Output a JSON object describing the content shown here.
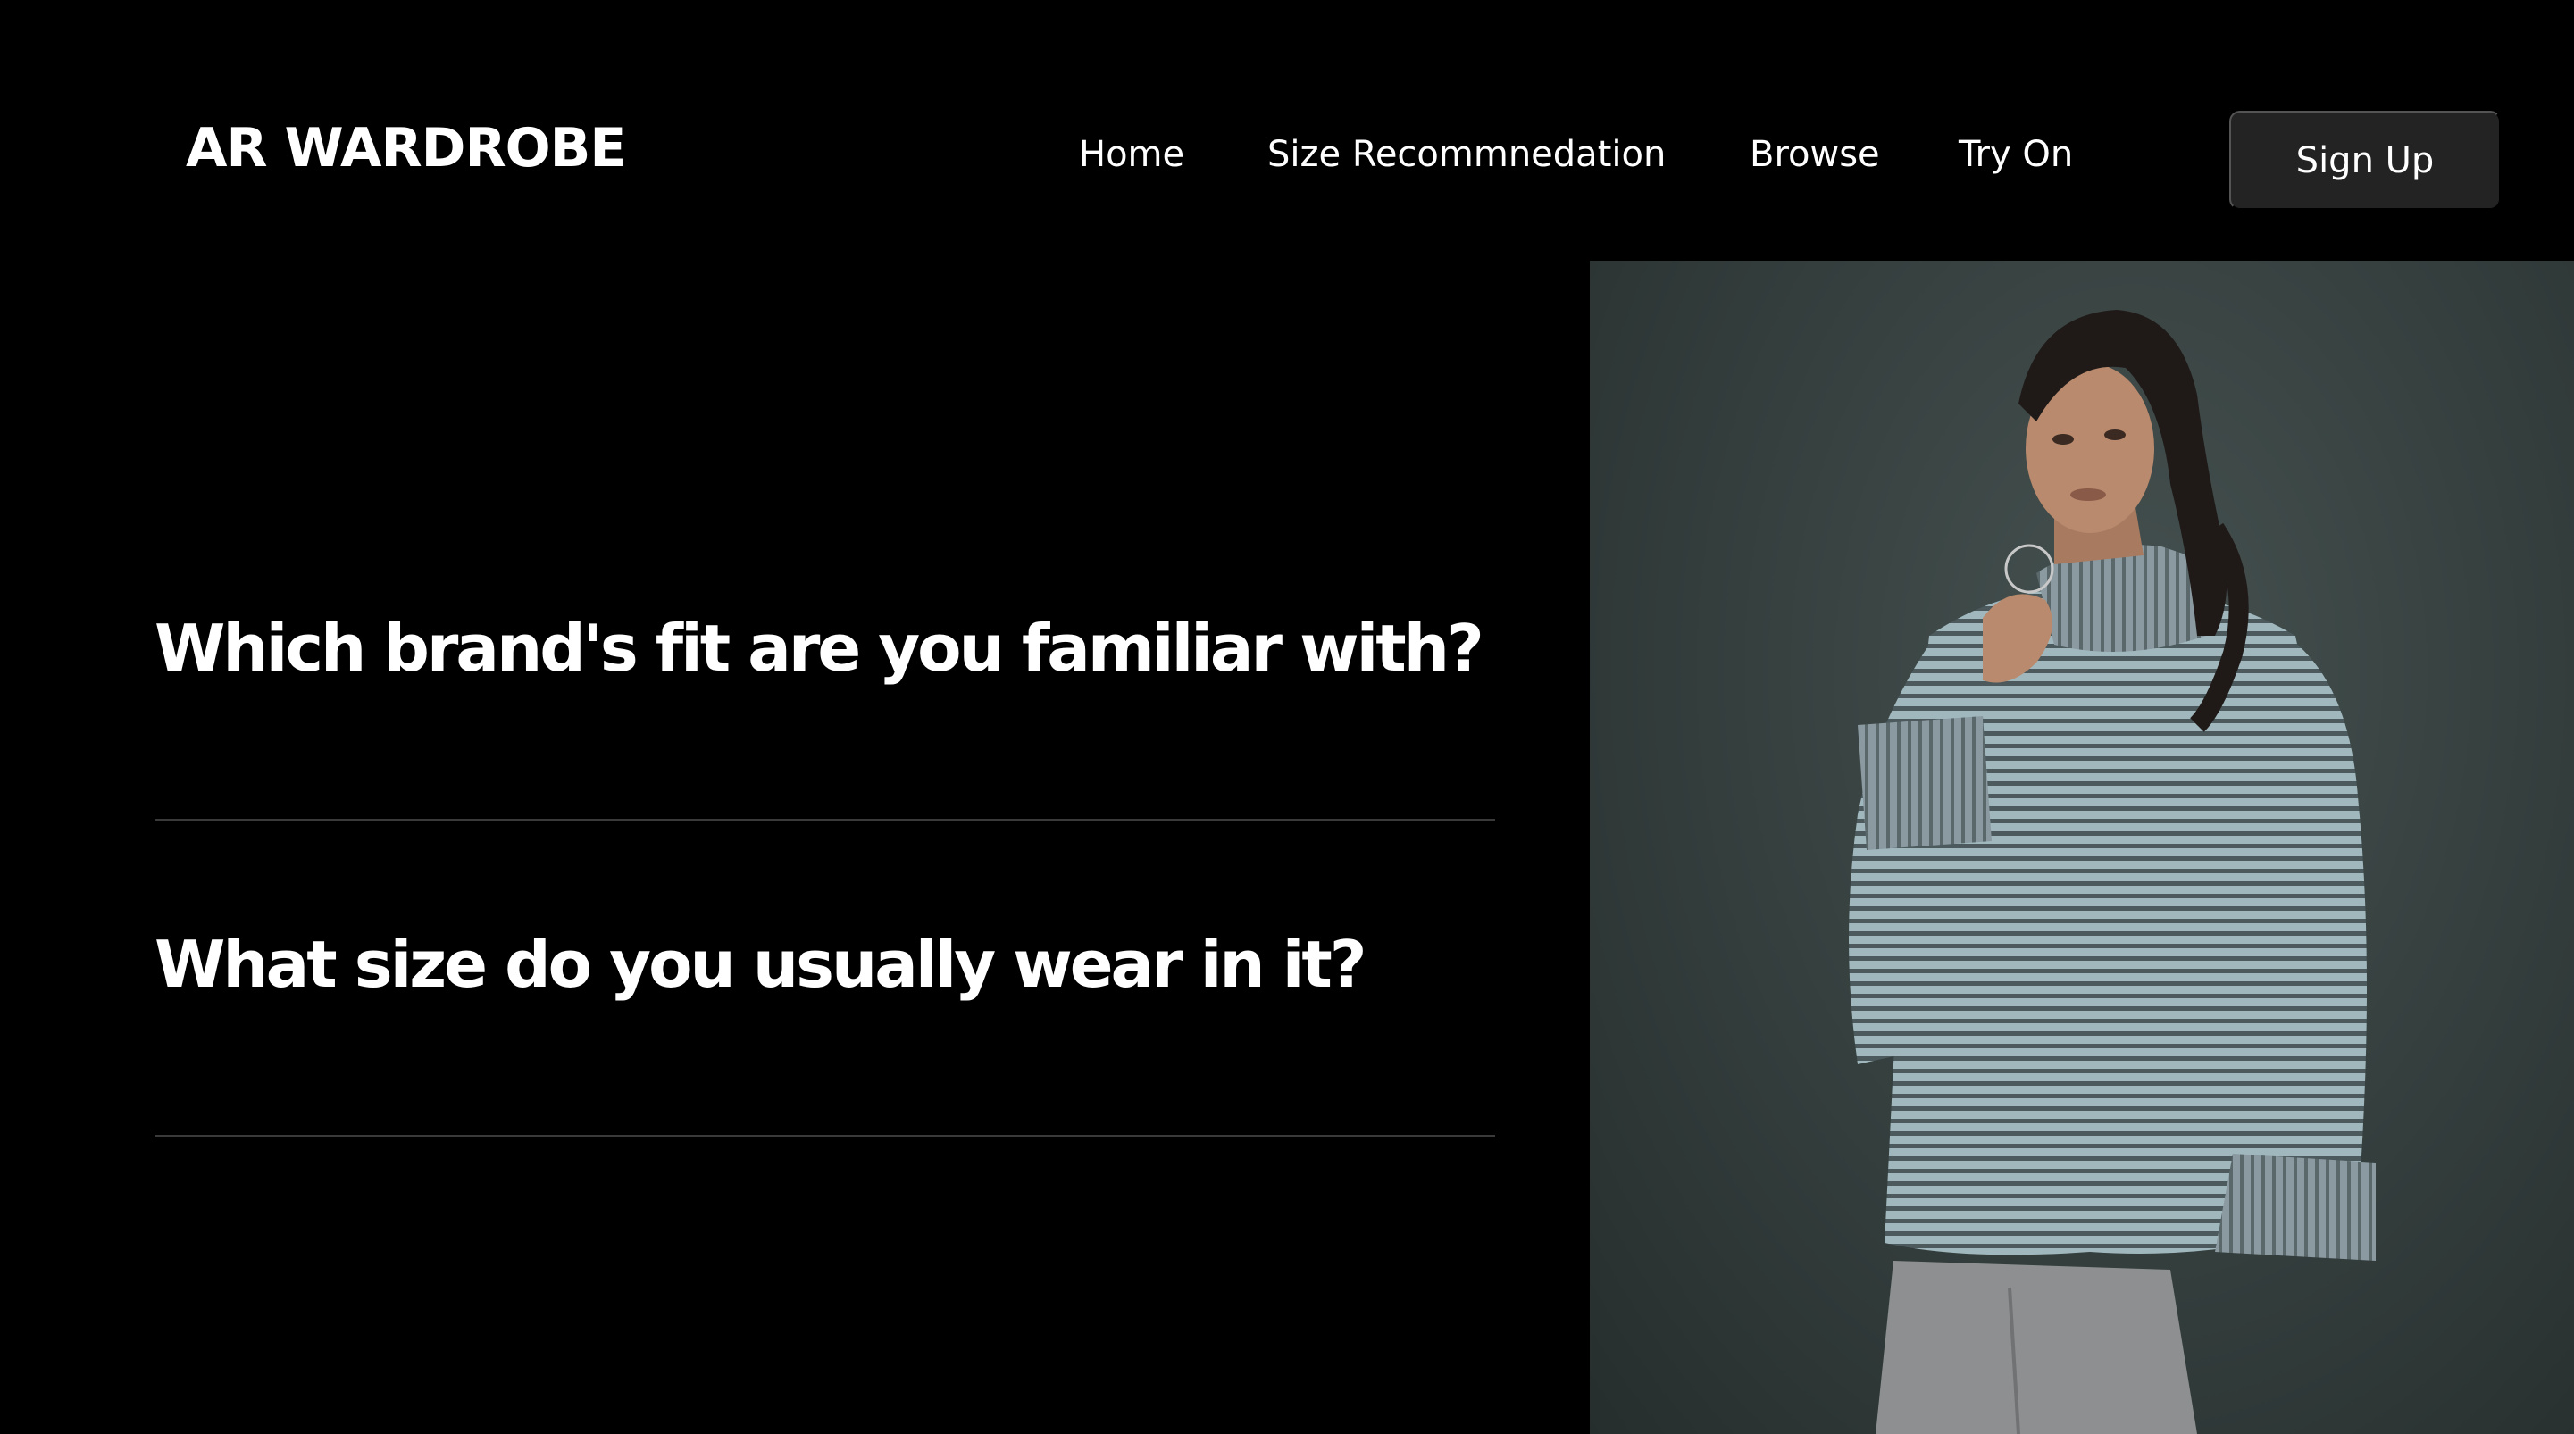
{
  "header": {
    "logo": "AR WARDROBE",
    "nav": [
      {
        "label": "Home"
      },
      {
        "label": "Size Recommnedation"
      },
      {
        "label": "Browse"
      },
      {
        "label": "Try On"
      }
    ],
    "signup_label": "Sign Up"
  },
  "main": {
    "questions": [
      {
        "text": "Which brand's fit are you familiar with?"
      },
      {
        "text": "What size do you usually wear in it?"
      }
    ]
  },
  "hero": {
    "image": "model-in-striped-turtleneck-sweater",
    "background_color": "#38423f"
  },
  "colors": {
    "page_background": "#000000",
    "text": "#ffffff",
    "button_background": "#232323",
    "divider": "#3a3a3a"
  }
}
